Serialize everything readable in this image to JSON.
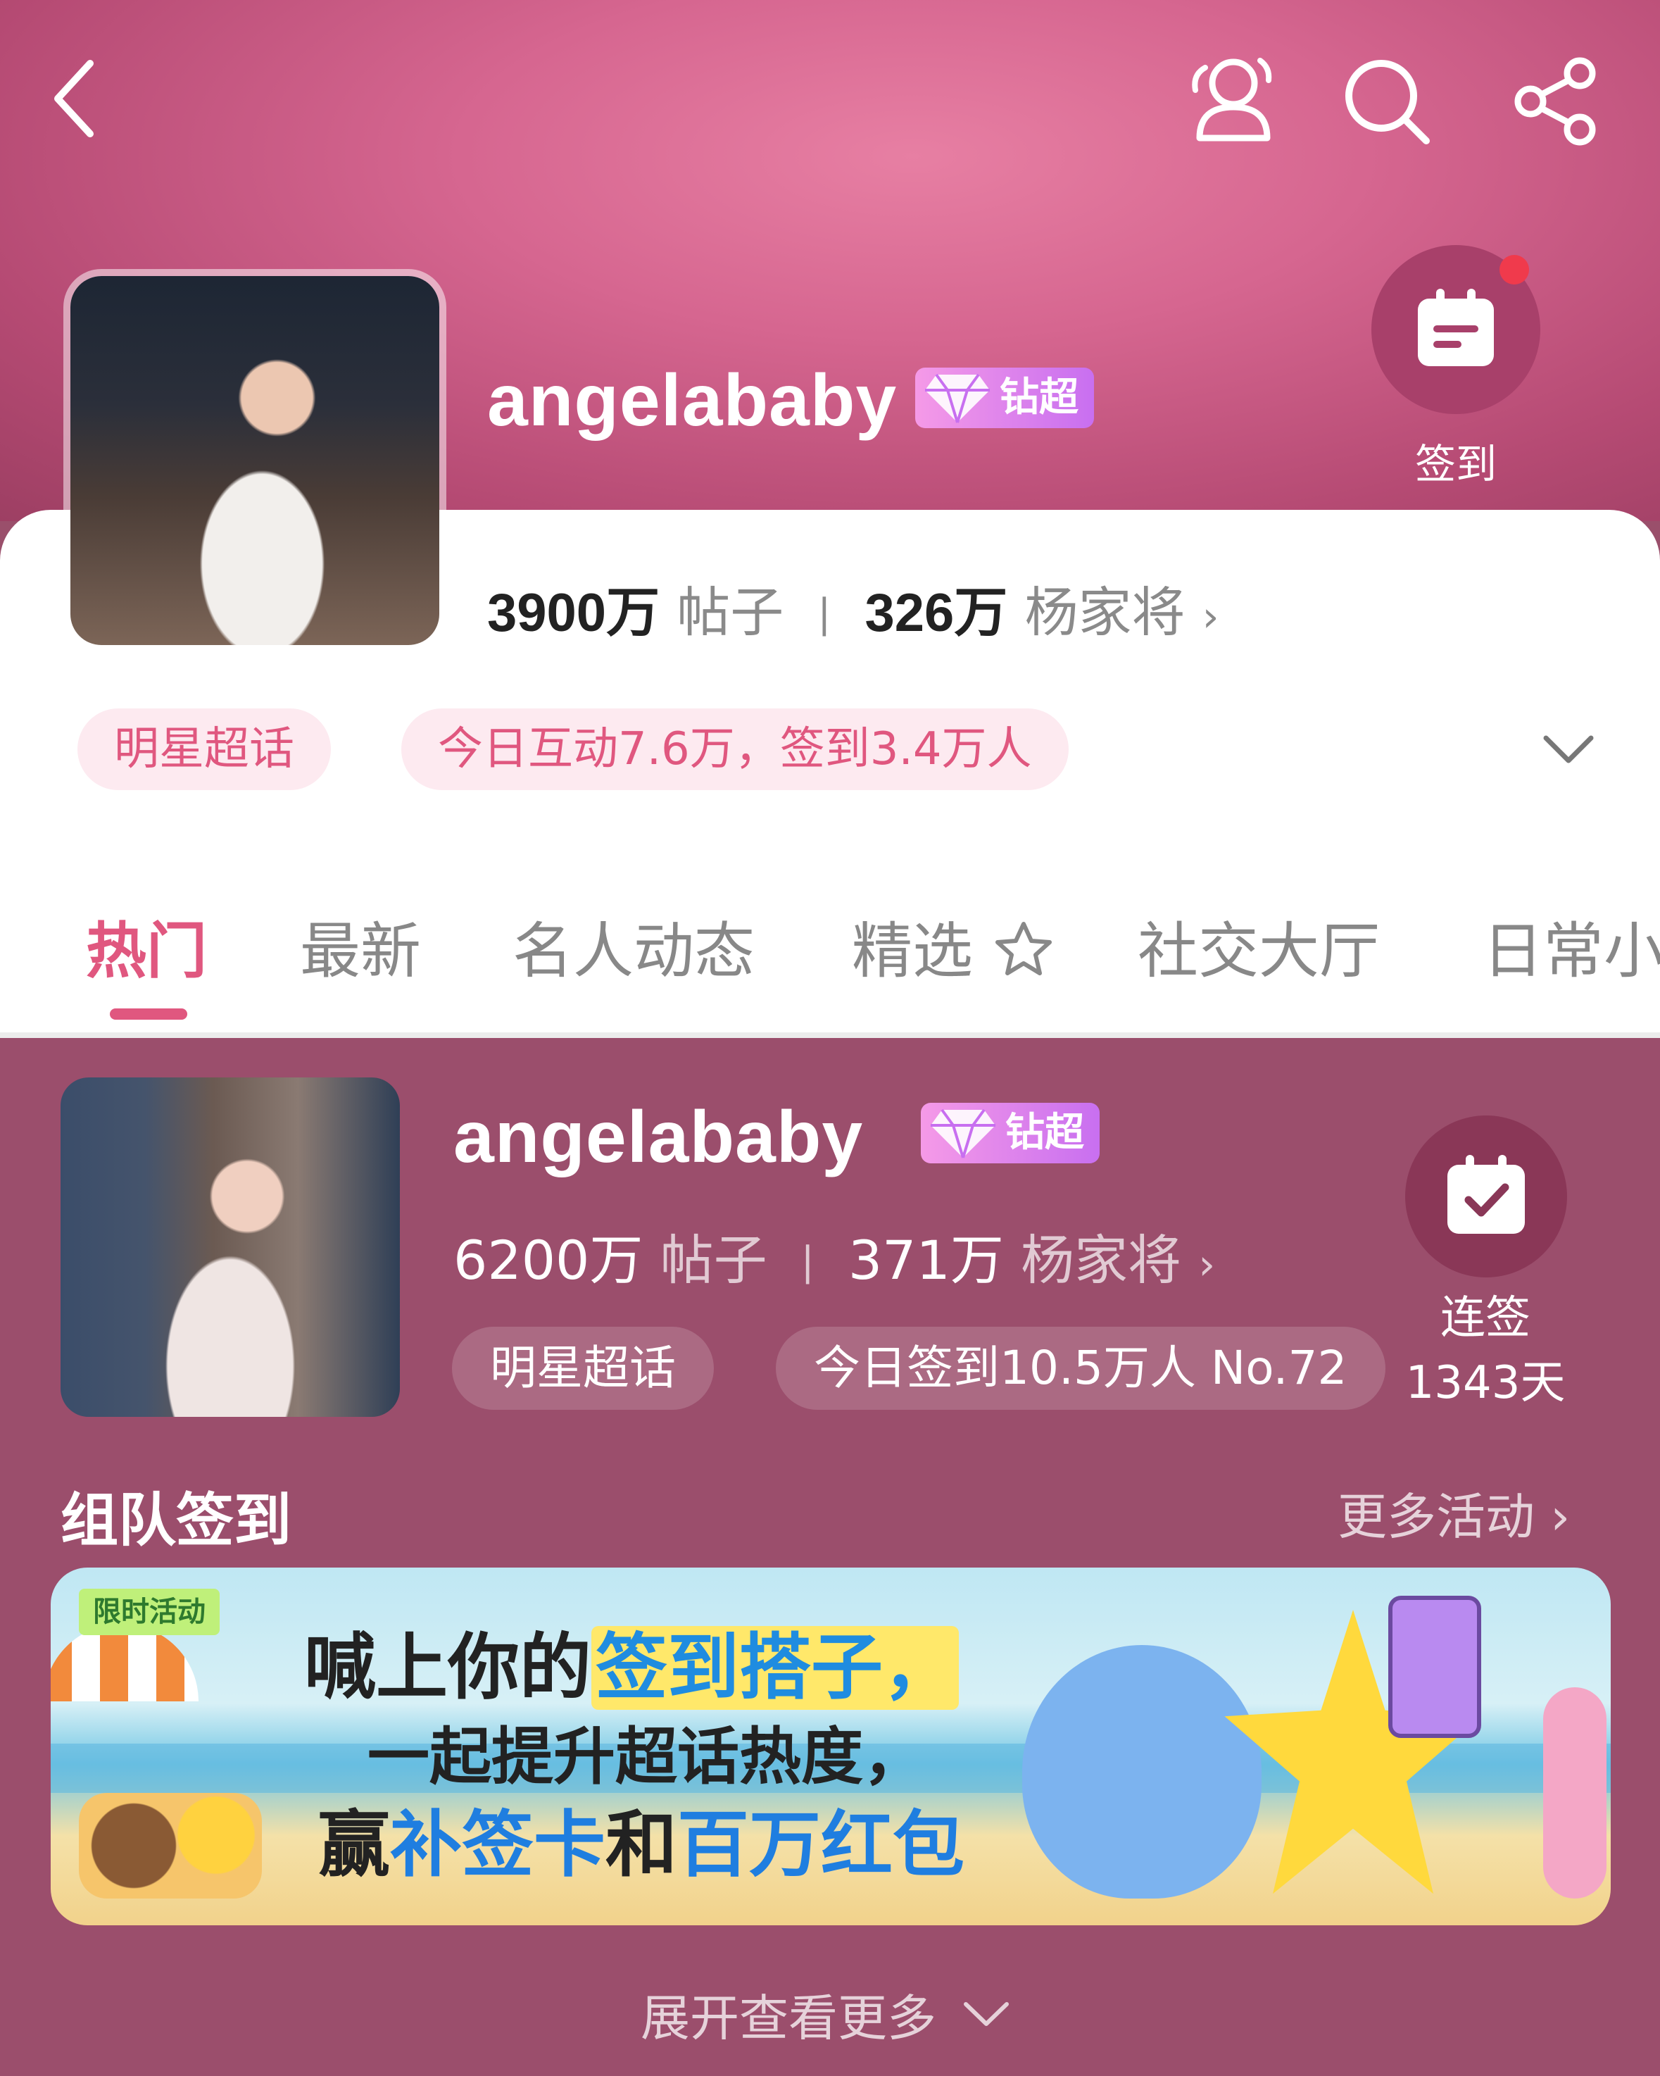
{
  "header": {
    "name": "angelababy",
    "badge": "钻超",
    "signin_label": "签到"
  },
  "stats_top": {
    "posts_num": "3900万",
    "posts_label": "帖子",
    "fans_num": "326万",
    "fans_label": "杨家将",
    "separator": "|"
  },
  "tags_top": {
    "category": "明星超话",
    "activity": "今日互动7.6万，签到3.4万人"
  },
  "tabs": [
    "热门",
    "最新",
    "名人动态",
    "精选",
    "社交大厅",
    "日常小"
  ],
  "card": {
    "name": "angelababy",
    "badge": "钻超",
    "posts_num": "6200万",
    "posts_label": "帖子",
    "fans_num": "371万",
    "fans_label": "杨家将",
    "separator": "|",
    "category": "明星超话",
    "checkin_info": "今日签到10.5万人 No.72",
    "streak_label": "连签",
    "streak_days": "1343天"
  },
  "section": {
    "title": "组队签到",
    "more": "更多活动"
  },
  "banner": {
    "tag": "限时活动",
    "line1_a": "喊上你的",
    "line1_b": "签到搭子，",
    "line2": "一起提升超话热度，",
    "line3_a": "赢",
    "line3_b": "补签卡",
    "line3_c": "和",
    "line3_d": "百万红包"
  },
  "footer": {
    "expand": "展开查看更多"
  },
  "colors": {
    "accent": "#e0577f",
    "card_bg": "#9b4e6c"
  }
}
